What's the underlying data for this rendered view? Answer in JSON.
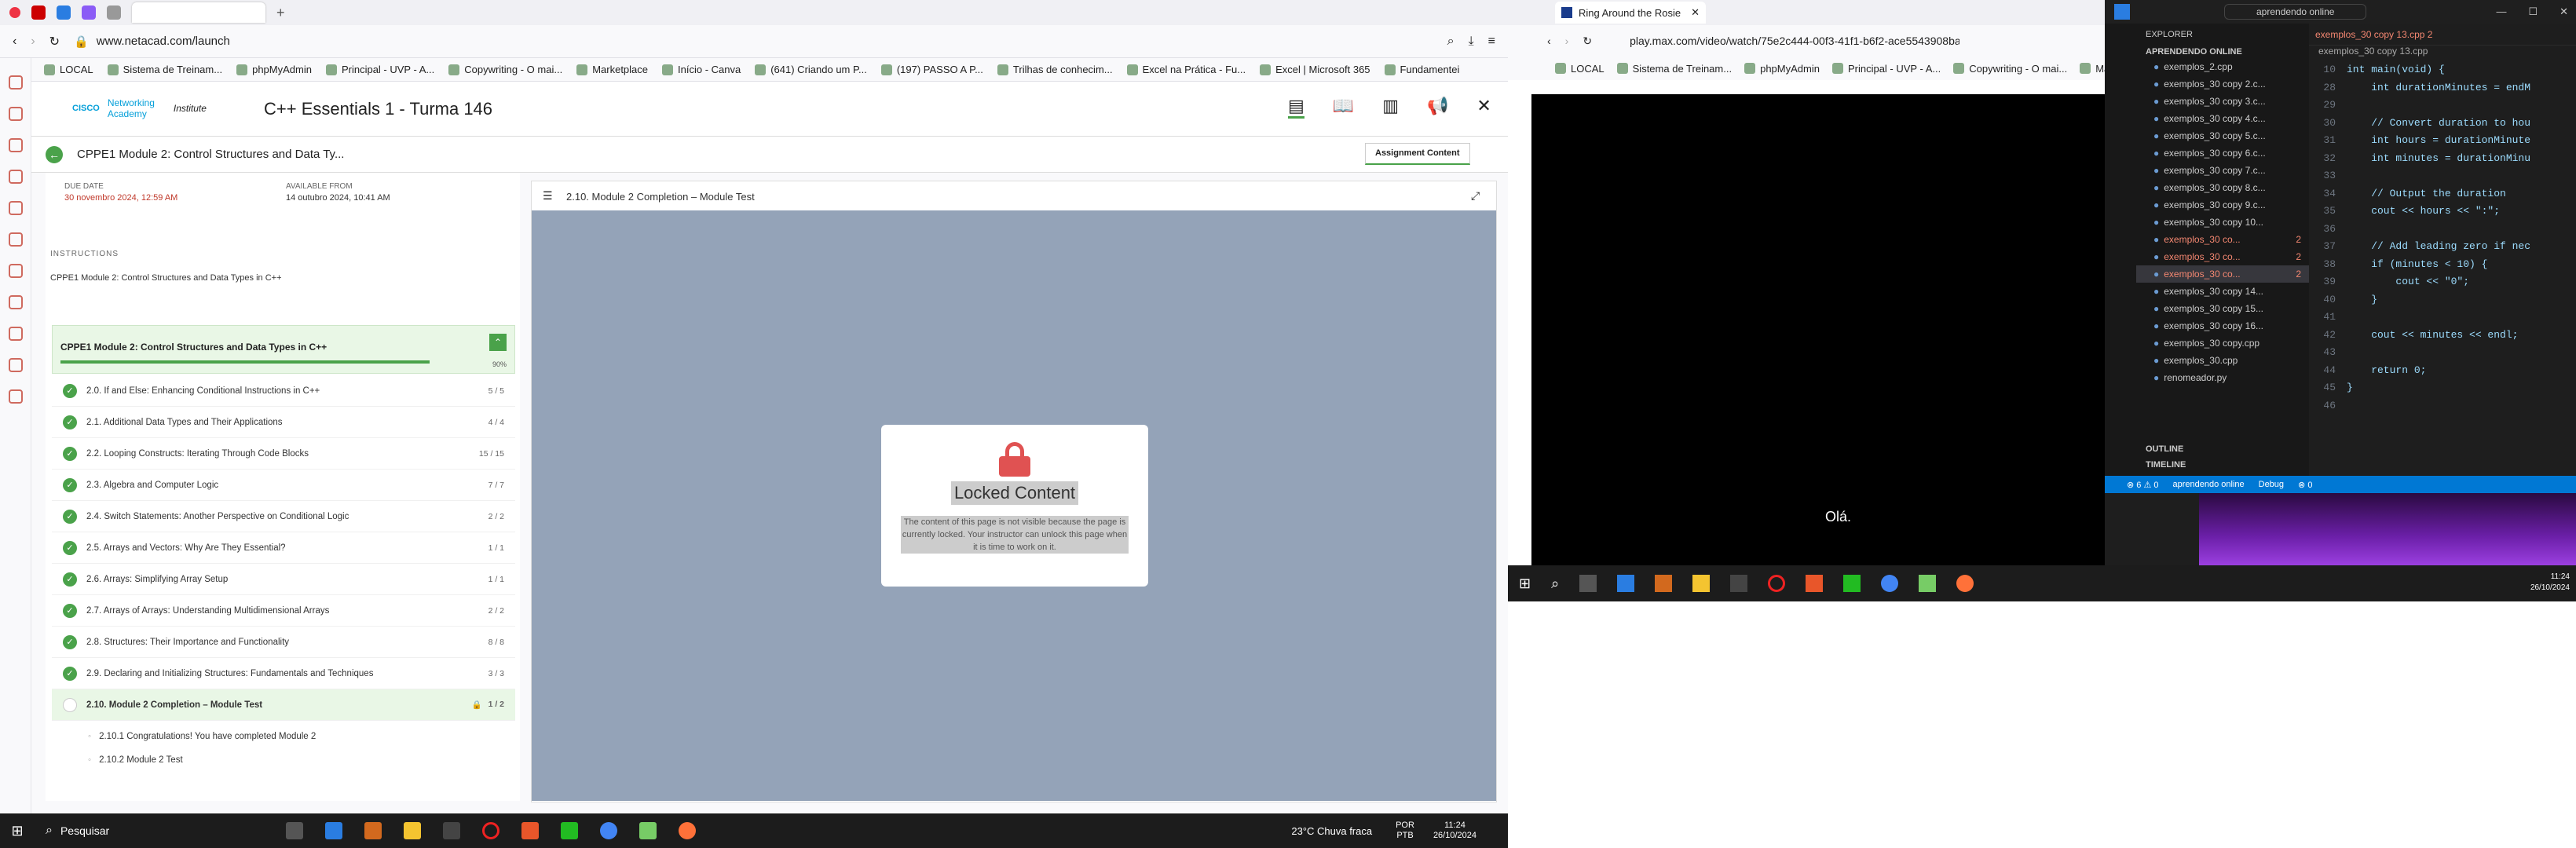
{
  "left_browser": {
    "url": "www.netacad.com/launch",
    "bookmarks": [
      "LOCAL",
      "Sistema de Treinam...",
      "phpMyAdmin",
      "Principal - UVP - A...",
      "Copywriting - O mai...",
      "Marketplace",
      "Início - Canva",
      "(641) Criando um P...",
      "(197) PASSO A P...",
      "Trilhas de conhecim...",
      "Excel na Prática - Fu...",
      "Excel | Microsoft 365",
      "Fundamentei"
    ]
  },
  "netacad": {
    "logo_line1": "Networking",
    "logo_line2": "Academy",
    "logo_cisco": "CISCO",
    "logo_institute": "Institute",
    "course_title": "C++ Essentials 1 - Turma 146",
    "breadcrumb": "CPPE1 Module 2: Control Structures and Data Ty...",
    "assignment_tab": "Assignment Content",
    "due_label": "DUE DATE",
    "due_value": "30 novembro 2024, 12:59 AM",
    "avail_label": "AVAILABLE FROM",
    "avail_value": "14 outubro 2024, 10:41 AM",
    "instructions_label": "INSTRUCTIONS",
    "instructions_text": "CPPE1 Module 2: Control Structures and Data Types in C++",
    "module_title": "CPPE1 Module 2: Control Structures and Data Types in C++",
    "module_percent": "90%",
    "items": [
      {
        "label": "2.0. If and Else: Enhancing Conditional Instructions in C++",
        "count": "5 / 5"
      },
      {
        "label": "2.1. Additional Data Types and Their Applications",
        "count": "4 / 4"
      },
      {
        "label": "2.2. Looping Constructs: Iterating Through Code Blocks",
        "count": "15 / 15"
      },
      {
        "label": "2.3. Algebra and Computer Logic",
        "count": "7 / 7"
      },
      {
        "label": "2.4. Switch Statements: Another Perspective on Conditional Logic",
        "count": "2 / 2"
      },
      {
        "label": "2.5. Arrays and Vectors: Why Are They Essential?",
        "count": "1 / 1"
      },
      {
        "label": "2.6. Arrays: Simplifying Array Setup",
        "count": "1 / 1"
      },
      {
        "label": "2.7. Arrays of Arrays: Understanding Multidimensional Arrays",
        "count": "2 / 2"
      },
      {
        "label": "2.8. Structures: Their Importance and Functionality",
        "count": "8 / 8"
      },
      {
        "label": "2.9. Declaring and Initializing Structures: Fundamentals and Techniques",
        "count": "3 / 3"
      }
    ],
    "active_item": {
      "label": "2.10. Module 2 Completion – Module Test",
      "count": "1 / 2"
    },
    "sub_items": [
      "2.10.1 Congratulations! You have completed Module 2",
      "2.10.2 Module 2 Test"
    ],
    "content_title": "2.10. Module 2 Completion – Module Test",
    "locked_title": "Locked Content",
    "locked_text": "The content of this page is not visible because the page is currently locked. Your instructor can unlock this page when it is time to work on it."
  },
  "taskbar_left": {
    "search": "Pesquisar",
    "weather": "23°C Chuva fraca",
    "lang1": "POR",
    "lang2": "PTB",
    "time": "11:24",
    "date": "26/10/2024"
  },
  "right_browser": {
    "tab_title": "Ring Around the Rosie",
    "url": "play.max.com/video/watch/75e2c444-00f3-41f1-b6f2-ace5543908ba/",
    "bookmarks": [
      "LOCAL",
      "Sistema de Treinam...",
      "phpMyAdmin",
      "Principal - UVP - A...",
      "Copywriting - O mai...",
      "Marke"
    ],
    "subtitle": "Olá."
  },
  "vscode": {
    "search": "aprendendo online",
    "explorer": "EXPLORER",
    "folder": "APRENDENDO ONLINE",
    "active_tab": "exemplos_30 copy 13.cpp 2",
    "breadcrumb": "exemplos_30 copy 13.cpp",
    "files": [
      {
        "name": "exemplos_2.cpp",
        "badge": ""
      },
      {
        "name": "exemplos_30 copy 2.c...",
        "badge": ""
      },
      {
        "name": "exemplos_30 copy 3.c...",
        "badge": ""
      },
      {
        "name": "exemplos_30 copy 4.c...",
        "badge": ""
      },
      {
        "name": "exemplos_30 copy 5.c...",
        "badge": ""
      },
      {
        "name": "exemplos_30 copy 6.c...",
        "badge": ""
      },
      {
        "name": "exemplos_30 copy 7.c...",
        "badge": ""
      },
      {
        "name": "exemplos_30 copy 8.c...",
        "badge": ""
      },
      {
        "name": "exemplos_30 copy 9.c...",
        "badge": ""
      },
      {
        "name": "exemplos_30 copy 10...",
        "badge": ""
      },
      {
        "name": "exemplos_30 co...",
        "badge": "2"
      },
      {
        "name": "exemplos_30 co...",
        "badge": "2"
      },
      {
        "name": "exemplos_30 co...",
        "badge": "2"
      },
      {
        "name": "exemplos_30 copy 14...",
        "badge": ""
      },
      {
        "name": "exemplos_30 copy 15...",
        "badge": ""
      },
      {
        "name": "exemplos_30 copy 16...",
        "badge": ""
      },
      {
        "name": "exemplos_30 copy.cpp",
        "badge": ""
      },
      {
        "name": "exemplos_30.cpp",
        "badge": ""
      },
      {
        "name": "renomeador.py",
        "badge": ""
      }
    ],
    "outline": "OUTLINE",
    "timeline": "TIMELINE",
    "code": [
      {
        "n": "10",
        "t": "int main(void) {"
      },
      {
        "n": "28",
        "t": "    int durationMinutes = endM"
      },
      {
        "n": "29",
        "t": ""
      },
      {
        "n": "30",
        "t": "    // Convert duration to hou"
      },
      {
        "n": "31",
        "t": "    int hours = durationMinute"
      },
      {
        "n": "32",
        "t": "    int minutes = durationMinu"
      },
      {
        "n": "33",
        "t": ""
      },
      {
        "n": "34",
        "t": "    // Output the duration"
      },
      {
        "n": "35",
        "t": "    cout << hours << \":\";"
      },
      {
        "n": "36",
        "t": ""
      },
      {
        "n": "37",
        "t": "    // Add leading zero if nec"
      },
      {
        "n": "38",
        "t": "    if (minutes < 10) {"
      },
      {
        "n": "39",
        "t": "        cout << \"0\";"
      },
      {
        "n": "40",
        "t": "    }"
      },
      {
        "n": "41",
        "t": ""
      },
      {
        "n": "42",
        "t": "    cout << minutes << endl;"
      },
      {
        "n": "43",
        "t": ""
      },
      {
        "n": "44",
        "t": "    return 0;"
      },
      {
        "n": "45",
        "t": "}"
      },
      {
        "n": "46",
        "t": ""
      }
    ],
    "status_problems": "⊗ 6 ⚠ 0",
    "status_folder": "aprendendo online",
    "status_debug": "Debug",
    "status_zero": "⊗ 0"
  },
  "taskbar_right": {
    "time": "11:24",
    "date": "26/10/2024"
  }
}
